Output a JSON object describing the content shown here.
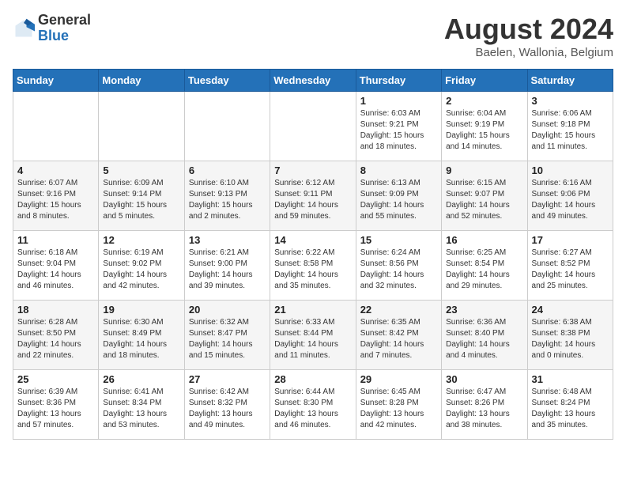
{
  "header": {
    "logo_line1": "General",
    "logo_line2": "Blue",
    "month_year": "August 2024",
    "location": "Baelen, Wallonia, Belgium"
  },
  "weekdays": [
    "Sunday",
    "Monday",
    "Tuesday",
    "Wednesday",
    "Thursday",
    "Friday",
    "Saturday"
  ],
  "weeks": [
    [
      {
        "day": "",
        "sunrise": "",
        "sunset": "",
        "daylight": ""
      },
      {
        "day": "",
        "sunrise": "",
        "sunset": "",
        "daylight": ""
      },
      {
        "day": "",
        "sunrise": "",
        "sunset": "",
        "daylight": ""
      },
      {
        "day": "",
        "sunrise": "",
        "sunset": "",
        "daylight": ""
      },
      {
        "day": "1",
        "sunrise": "Sunrise: 6:03 AM",
        "sunset": "Sunset: 9:21 PM",
        "daylight": "Daylight: 15 hours and 18 minutes."
      },
      {
        "day": "2",
        "sunrise": "Sunrise: 6:04 AM",
        "sunset": "Sunset: 9:19 PM",
        "daylight": "Daylight: 15 hours and 14 minutes."
      },
      {
        "day": "3",
        "sunrise": "Sunrise: 6:06 AM",
        "sunset": "Sunset: 9:18 PM",
        "daylight": "Daylight: 15 hours and 11 minutes."
      }
    ],
    [
      {
        "day": "4",
        "sunrise": "Sunrise: 6:07 AM",
        "sunset": "Sunset: 9:16 PM",
        "daylight": "Daylight: 15 hours and 8 minutes."
      },
      {
        "day": "5",
        "sunrise": "Sunrise: 6:09 AM",
        "sunset": "Sunset: 9:14 PM",
        "daylight": "Daylight: 15 hours and 5 minutes."
      },
      {
        "day": "6",
        "sunrise": "Sunrise: 6:10 AM",
        "sunset": "Sunset: 9:13 PM",
        "daylight": "Daylight: 15 hours and 2 minutes."
      },
      {
        "day": "7",
        "sunrise": "Sunrise: 6:12 AM",
        "sunset": "Sunset: 9:11 PM",
        "daylight": "Daylight: 14 hours and 59 minutes."
      },
      {
        "day": "8",
        "sunrise": "Sunrise: 6:13 AM",
        "sunset": "Sunset: 9:09 PM",
        "daylight": "Daylight: 14 hours and 55 minutes."
      },
      {
        "day": "9",
        "sunrise": "Sunrise: 6:15 AM",
        "sunset": "Sunset: 9:07 PM",
        "daylight": "Daylight: 14 hours and 52 minutes."
      },
      {
        "day": "10",
        "sunrise": "Sunrise: 6:16 AM",
        "sunset": "Sunset: 9:06 PM",
        "daylight": "Daylight: 14 hours and 49 minutes."
      }
    ],
    [
      {
        "day": "11",
        "sunrise": "Sunrise: 6:18 AM",
        "sunset": "Sunset: 9:04 PM",
        "daylight": "Daylight: 14 hours and 46 minutes."
      },
      {
        "day": "12",
        "sunrise": "Sunrise: 6:19 AM",
        "sunset": "Sunset: 9:02 PM",
        "daylight": "Daylight: 14 hours and 42 minutes."
      },
      {
        "day": "13",
        "sunrise": "Sunrise: 6:21 AM",
        "sunset": "Sunset: 9:00 PM",
        "daylight": "Daylight: 14 hours and 39 minutes."
      },
      {
        "day": "14",
        "sunrise": "Sunrise: 6:22 AM",
        "sunset": "Sunset: 8:58 PM",
        "daylight": "Daylight: 14 hours and 35 minutes."
      },
      {
        "day": "15",
        "sunrise": "Sunrise: 6:24 AM",
        "sunset": "Sunset: 8:56 PM",
        "daylight": "Daylight: 14 hours and 32 minutes."
      },
      {
        "day": "16",
        "sunrise": "Sunrise: 6:25 AM",
        "sunset": "Sunset: 8:54 PM",
        "daylight": "Daylight: 14 hours and 29 minutes."
      },
      {
        "day": "17",
        "sunrise": "Sunrise: 6:27 AM",
        "sunset": "Sunset: 8:52 PM",
        "daylight": "Daylight: 14 hours and 25 minutes."
      }
    ],
    [
      {
        "day": "18",
        "sunrise": "Sunrise: 6:28 AM",
        "sunset": "Sunset: 8:50 PM",
        "daylight": "Daylight: 14 hours and 22 minutes."
      },
      {
        "day": "19",
        "sunrise": "Sunrise: 6:30 AM",
        "sunset": "Sunset: 8:49 PM",
        "daylight": "Daylight: 14 hours and 18 minutes."
      },
      {
        "day": "20",
        "sunrise": "Sunrise: 6:32 AM",
        "sunset": "Sunset: 8:47 PM",
        "daylight": "Daylight: 14 hours and 15 minutes."
      },
      {
        "day": "21",
        "sunrise": "Sunrise: 6:33 AM",
        "sunset": "Sunset: 8:44 PM",
        "daylight": "Daylight: 14 hours and 11 minutes."
      },
      {
        "day": "22",
        "sunrise": "Sunrise: 6:35 AM",
        "sunset": "Sunset: 8:42 PM",
        "daylight": "Daylight: 14 hours and 7 minutes."
      },
      {
        "day": "23",
        "sunrise": "Sunrise: 6:36 AM",
        "sunset": "Sunset: 8:40 PM",
        "daylight": "Daylight: 14 hours and 4 minutes."
      },
      {
        "day": "24",
        "sunrise": "Sunrise: 6:38 AM",
        "sunset": "Sunset: 8:38 PM",
        "daylight": "Daylight: 14 hours and 0 minutes."
      }
    ],
    [
      {
        "day": "25",
        "sunrise": "Sunrise: 6:39 AM",
        "sunset": "Sunset: 8:36 PM",
        "daylight": "Daylight: 13 hours and 57 minutes."
      },
      {
        "day": "26",
        "sunrise": "Sunrise: 6:41 AM",
        "sunset": "Sunset: 8:34 PM",
        "daylight": "Daylight: 13 hours and 53 minutes."
      },
      {
        "day": "27",
        "sunrise": "Sunrise: 6:42 AM",
        "sunset": "Sunset: 8:32 PM",
        "daylight": "Daylight: 13 hours and 49 minutes."
      },
      {
        "day": "28",
        "sunrise": "Sunrise: 6:44 AM",
        "sunset": "Sunset: 8:30 PM",
        "daylight": "Daylight: 13 hours and 46 minutes."
      },
      {
        "day": "29",
        "sunrise": "Sunrise: 6:45 AM",
        "sunset": "Sunset: 8:28 PM",
        "daylight": "Daylight: 13 hours and 42 minutes."
      },
      {
        "day": "30",
        "sunrise": "Sunrise: 6:47 AM",
        "sunset": "Sunset: 8:26 PM",
        "daylight": "Daylight: 13 hours and 38 minutes."
      },
      {
        "day": "31",
        "sunrise": "Sunrise: 6:48 AM",
        "sunset": "Sunset: 8:24 PM",
        "daylight": "Daylight: 13 hours and 35 minutes."
      }
    ]
  ]
}
